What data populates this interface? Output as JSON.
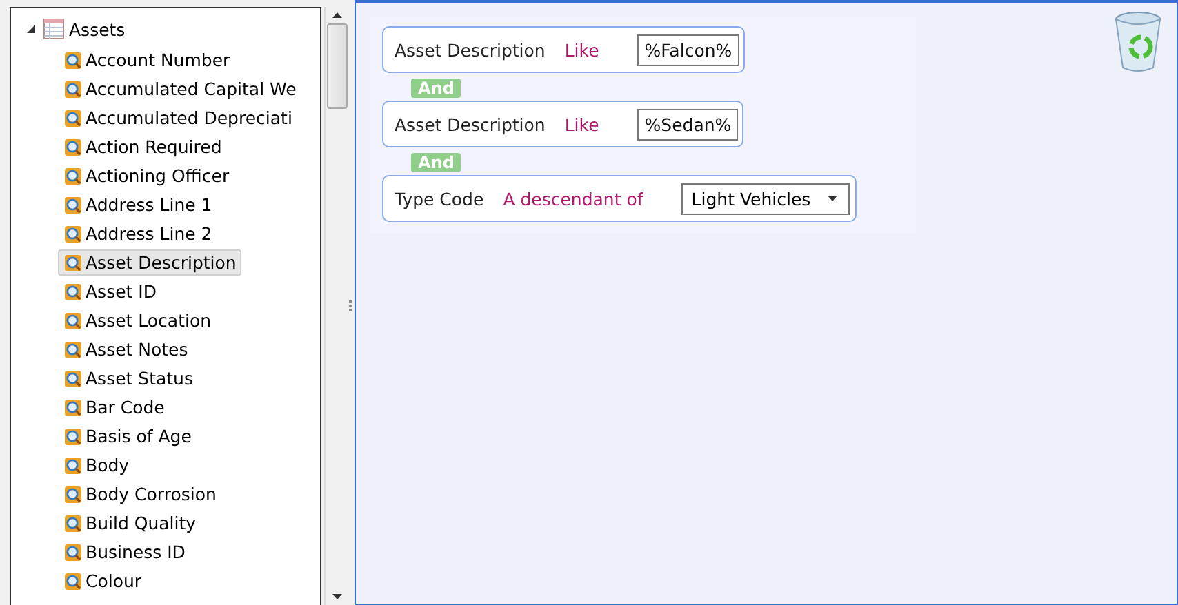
{
  "tree": {
    "root": {
      "label": "Assets",
      "expanded": true,
      "children": [
        {
          "label": "Account Number",
          "selected": false
        },
        {
          "label": "Accumulated Capital We",
          "selected": false
        },
        {
          "label": "Accumulated Depreciati",
          "selected": false
        },
        {
          "label": "Action Required",
          "selected": false
        },
        {
          "label": "Actioning Officer",
          "selected": false
        },
        {
          "label": "Address Line 1",
          "selected": false
        },
        {
          "label": "Address Line 2",
          "selected": false
        },
        {
          "label": "Asset Description",
          "selected": true
        },
        {
          "label": "Asset ID",
          "selected": false
        },
        {
          "label": "Asset Location",
          "selected": false
        },
        {
          "label": "Asset Notes",
          "selected": false
        },
        {
          "label": "Asset Status",
          "selected": false
        },
        {
          "label": "Bar Code",
          "selected": false
        },
        {
          "label": "Basis of Age",
          "selected": false
        },
        {
          "label": "Body",
          "selected": false
        },
        {
          "label": "Body Corrosion",
          "selected": false
        },
        {
          "label": "Build Quality",
          "selected": false
        },
        {
          "label": "Business ID",
          "selected": false
        },
        {
          "label": "Colour",
          "selected": false
        }
      ]
    }
  },
  "criteria": [
    {
      "kind": "text",
      "field": "Asset Description",
      "operator": "Like",
      "value": "%Falcon%"
    },
    {
      "kind": "join",
      "label": "And"
    },
    {
      "kind": "text",
      "field": "Asset Description",
      "operator": "Like",
      "value": "%Sedan%"
    },
    {
      "kind": "join",
      "label": "And"
    },
    {
      "kind": "dropdown",
      "field": "Type Code",
      "operator": "A descendant of",
      "value": "Light Vehicles"
    }
  ]
}
